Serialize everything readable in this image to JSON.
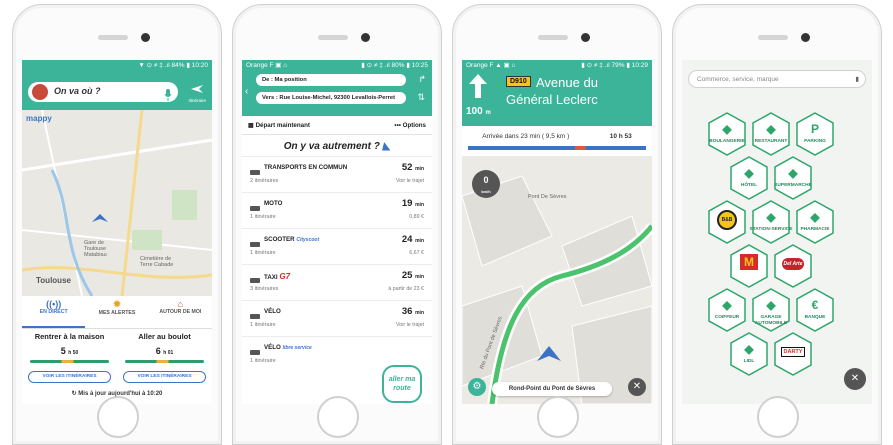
{
  "colors": {
    "brand": "#3bb49a",
    "accent_blue": "#3b74c7",
    "green_icon": "#2ea66a",
    "route_green": "#4bc26c"
  },
  "phone1": {
    "status": {
      "right": "▼ ⊙ ≠ ‡ .ıl 84% ▮ 10:20"
    },
    "search_placeholder": "On va où ?",
    "itinerary_label": "Itinéraire",
    "logo": "mappy",
    "map_city": "Toulouse",
    "map_labels": [
      "Gare de Toulouse Matabiau",
      "Cimetière de Terre Cabade"
    ],
    "tabs": [
      {
        "label": "EN DIRECT",
        "icon": "live-icon"
      },
      {
        "label": "MES ALERTES",
        "icon": "alert-icon"
      },
      {
        "label": "AUTOUR DE MOI",
        "icon": "around-icon"
      }
    ],
    "cards": [
      {
        "title": "Rentrer à la maison",
        "duration": "5",
        "unit": "h 50",
        "button": "VOIR LES ITINÉRAIRES"
      },
      {
        "title": "Aller au boulot",
        "duration": "6",
        "unit": "h 01",
        "button": "VOIR LES ITINÉRAIRES"
      }
    ],
    "update_text": "Mis à jour aujourd'hui à 10:20"
  },
  "phone2": {
    "status": {
      "left": "Orange F ▣ ⌂",
      "right": "▮ ⊙ ≠ ‡ .ıl 80% ▮ 10:25"
    },
    "from": "De : Ma position",
    "to": "Vers : Rue Louise-Michel, 92300 Levallois-Perret",
    "depart": "Départ maintenant",
    "options": "Options",
    "slogan": "On y va autrement ?",
    "rows": [
      {
        "name": "TRANSPORTS EN COMMUN",
        "sub": "2 itinéraires",
        "time": "52",
        "unit": "min",
        "price": "Voir le trajet",
        "icon": "bus-icon"
      },
      {
        "name": "MOTO",
        "sub": "1 itinéraire",
        "time": "19",
        "unit": "min",
        "price": "0,89 €",
        "icon": "moto-icon"
      },
      {
        "name": "SCOOTER",
        "brand": "Cityscoot",
        "sub": "1 itinéraire",
        "time": "24",
        "unit": "min",
        "price": "6,67 €",
        "icon": "scooter-icon"
      },
      {
        "name": "TAXI",
        "brand": "G7",
        "sub": "3 itinéraires",
        "time": "25",
        "unit": "min",
        "price": "à partir de 23 €",
        "icon": "taxi-icon"
      },
      {
        "name": "VÉLO",
        "sub": "1 itinéraire",
        "time": "36",
        "unit": "min",
        "price": "Voir le trajet",
        "icon": "bike-icon"
      },
      {
        "name": "VÉLO",
        "brand": "libre service",
        "sub": "1 itinéraire",
        "time": "",
        "unit": "",
        "price": "",
        "icon": "bike-icon"
      }
    ],
    "fab": "aller ma route"
  },
  "phone3": {
    "status": {
      "left": "Orange F ▲ ▣ ⌂",
      "right": "▮ ⊙ ≠ ‡ .ıl 79% ▮ 10:29"
    },
    "road_badge": "D910",
    "street": "Avenue du Général Leclerc",
    "distance": "100",
    "distance_unit": "m",
    "eta_text": "Arrivée dans 23 min ( 9,5 km )",
    "eta_time": "10 h 53",
    "speed": "0",
    "speed_unit": "km/h",
    "map_poi": "Pont De Sèvres",
    "map_street": "Rte du Pont de Sèvres",
    "bottom_street": "Rond-Point du Pont de Sèvres"
  },
  "phone4": {
    "search_placeholder": "Commerce, service, marque",
    "categories": [
      {
        "label": "BOULANGERIE",
        "icon": "bread-icon"
      },
      {
        "label": "RESTAURANT",
        "icon": "fork-knife-icon"
      },
      {
        "label": "PARKING",
        "icon": "parking-icon",
        "glyph": "P"
      },
      {
        "label": "HÔTEL",
        "icon": "bed-icon"
      },
      {
        "label": "SUPERMARCHÉ",
        "icon": "cart-icon"
      },
      {
        "label": "",
        "icon": "brand-bb-icon",
        "brand": "B&B"
      },
      {
        "label": "STATION-SERVICE",
        "icon": "fuel-icon"
      },
      {
        "label": "PHARMACIE",
        "icon": "pharmacy-icon"
      },
      {
        "label": "",
        "icon": "mcdonalds-icon",
        "brand": "M"
      },
      {
        "label": "",
        "icon": "del-arte-icon",
        "brand": "Del Arte"
      },
      {
        "label": "COIFFEUR",
        "icon": "scissors-icon"
      },
      {
        "label": "GARAGE AUTOMOBILE",
        "icon": "wrench-icon"
      },
      {
        "label": "BANQUE",
        "icon": "euro-icon",
        "glyph": "€"
      },
      {
        "label": "LIDL",
        "icon": "lidl-icon"
      },
      {
        "label": "",
        "icon": "darty-icon",
        "brand": "DARTY"
      }
    ]
  }
}
